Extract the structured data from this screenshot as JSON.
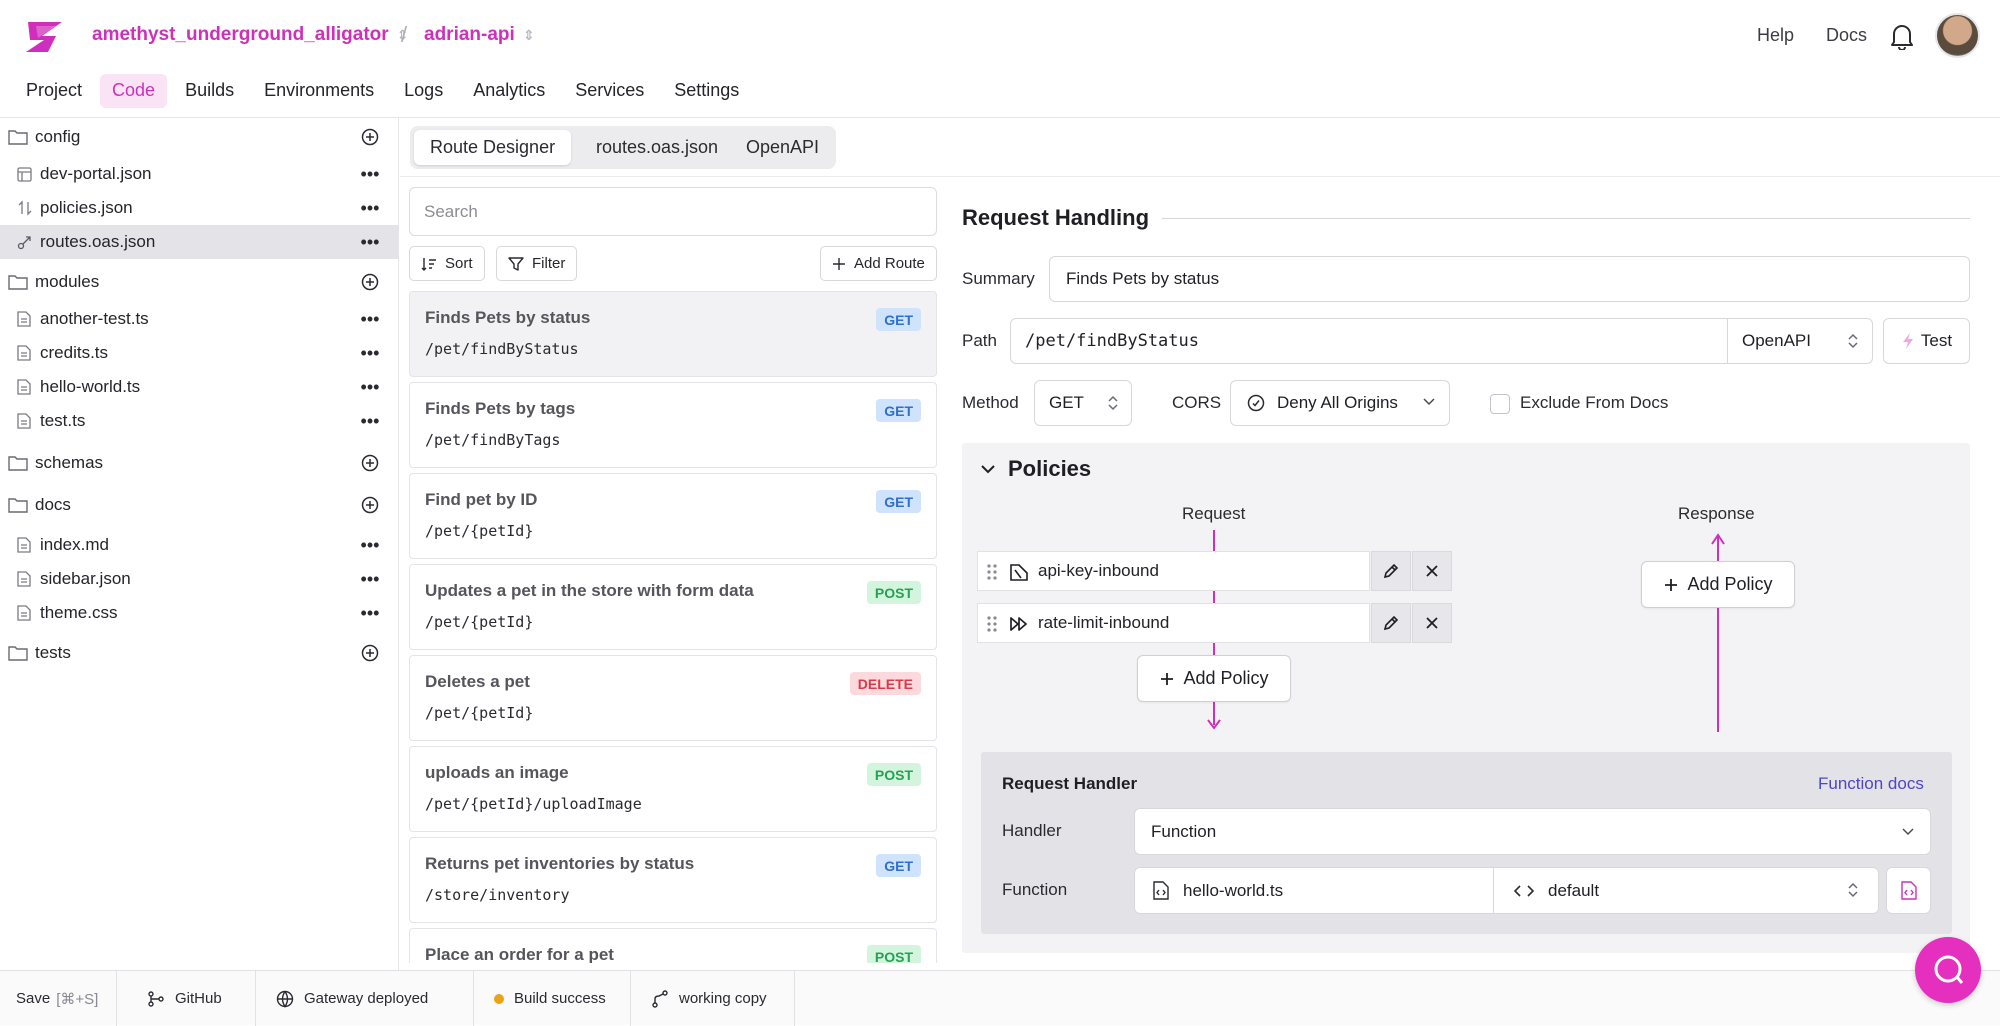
{
  "header": {
    "project_name": "amethyst_underground_alligator",
    "separator": "/",
    "environment_name": "adrian-api",
    "help_label": "Help",
    "docs_label": "Docs"
  },
  "nav": {
    "tabs": [
      {
        "label": "Project"
      },
      {
        "label": "Code",
        "active": true
      },
      {
        "label": "Builds"
      },
      {
        "label": "Environments"
      },
      {
        "label": "Logs"
      },
      {
        "label": "Analytics"
      },
      {
        "label": "Services"
      },
      {
        "label": "Settings"
      }
    ]
  },
  "sidebar": {
    "items": [
      {
        "type": "folder",
        "label": "config"
      },
      {
        "type": "file",
        "label": "dev-portal.json",
        "icon": "layout-icon"
      },
      {
        "type": "file",
        "label": "policies.json",
        "icon": "arrows-updown-icon"
      },
      {
        "type": "file",
        "label": "routes.oas.json",
        "icon": "route-icon",
        "selected": true
      },
      {
        "type": "folder",
        "label": "modules"
      },
      {
        "type": "file",
        "label": "another-test.ts",
        "icon": "file-icon"
      },
      {
        "type": "file",
        "label": "credits.ts",
        "icon": "file-icon"
      },
      {
        "type": "file",
        "label": "hello-world.ts",
        "icon": "file-icon"
      },
      {
        "type": "file",
        "label": "test.ts",
        "icon": "file-icon"
      },
      {
        "type": "folder",
        "label": "schemas"
      },
      {
        "type": "folder",
        "label": "docs"
      },
      {
        "type": "file",
        "label": "index.md",
        "icon": "file-icon"
      },
      {
        "type": "file",
        "label": "sidebar.json",
        "icon": "file-icon"
      },
      {
        "type": "file",
        "label": "theme.css",
        "icon": "file-icon"
      },
      {
        "type": "folder",
        "label": "tests"
      }
    ]
  },
  "editor_tabs": {
    "route_designer": "Route Designer",
    "routes_json": "routes.oas.json",
    "openapi": "OpenAPI"
  },
  "routes_panel": {
    "search_placeholder": "Search",
    "sort_label": "Sort",
    "filter_label": "Filter",
    "add_route_label": "Add Route",
    "routes": [
      {
        "title": "Finds Pets by status",
        "path": "/pet/findByStatus",
        "method": "GET",
        "selected": true
      },
      {
        "title": "Finds Pets by tags",
        "path": "/pet/findByTags",
        "method": "GET"
      },
      {
        "title": "Find pet by ID",
        "path": "/pet/{petId}",
        "method": "GET"
      },
      {
        "title": "Updates a pet in the store with form data",
        "path": "/pet/{petId}",
        "method": "POST"
      },
      {
        "title": "Deletes a pet",
        "path": "/pet/{petId}",
        "method": "DELETE"
      },
      {
        "title": "uploads an image",
        "path": "/pet/{petId}/uploadImage",
        "method": "POST"
      },
      {
        "title": "Returns pet inventories by status",
        "path": "/store/inventory",
        "method": "GET"
      },
      {
        "title": "Place an order for a pet",
        "path": "",
        "method": "POST"
      }
    ]
  },
  "request_handling": {
    "title": "Request Handling",
    "summary_label": "Summary",
    "summary_value": "Finds Pets by status",
    "path_label": "Path",
    "path_value": "/pet/findByStatus",
    "path_mode": "OpenAPI",
    "test_label": "Test",
    "method_label": "Method",
    "method_value": "GET",
    "cors_label": "CORS",
    "cors_value": "Deny All Origins",
    "exclude_label": "Exclude From Docs",
    "exclude_checked": false
  },
  "policies": {
    "title": "Policies",
    "request_label": "Request",
    "response_label": "Response",
    "inbound": [
      {
        "name": "api-key-inbound",
        "icon": "key-shield-icon"
      },
      {
        "name": "rate-limit-inbound",
        "icon": "fast-forward-icon"
      }
    ],
    "add_policy_label": "Add Policy"
  },
  "request_handler": {
    "title": "Request Handler",
    "docs_link": "Function docs",
    "handler_label": "Handler",
    "handler_value": "Function",
    "function_label": "Function",
    "function_file": "hello-world.ts",
    "function_export": "default"
  },
  "statusbar": {
    "save_label": "Save",
    "save_shortcut": "[⌘+S]",
    "github_label": "GitHub",
    "gateway_label": "Gateway deployed",
    "build_label": "Build success",
    "working_copy_label": "working copy"
  },
  "colors": {
    "brand": "#d02fbd",
    "get": "#2f6fcf",
    "post": "#27a152",
    "delete": "#d83a48",
    "build_dot": "#e8a317"
  }
}
